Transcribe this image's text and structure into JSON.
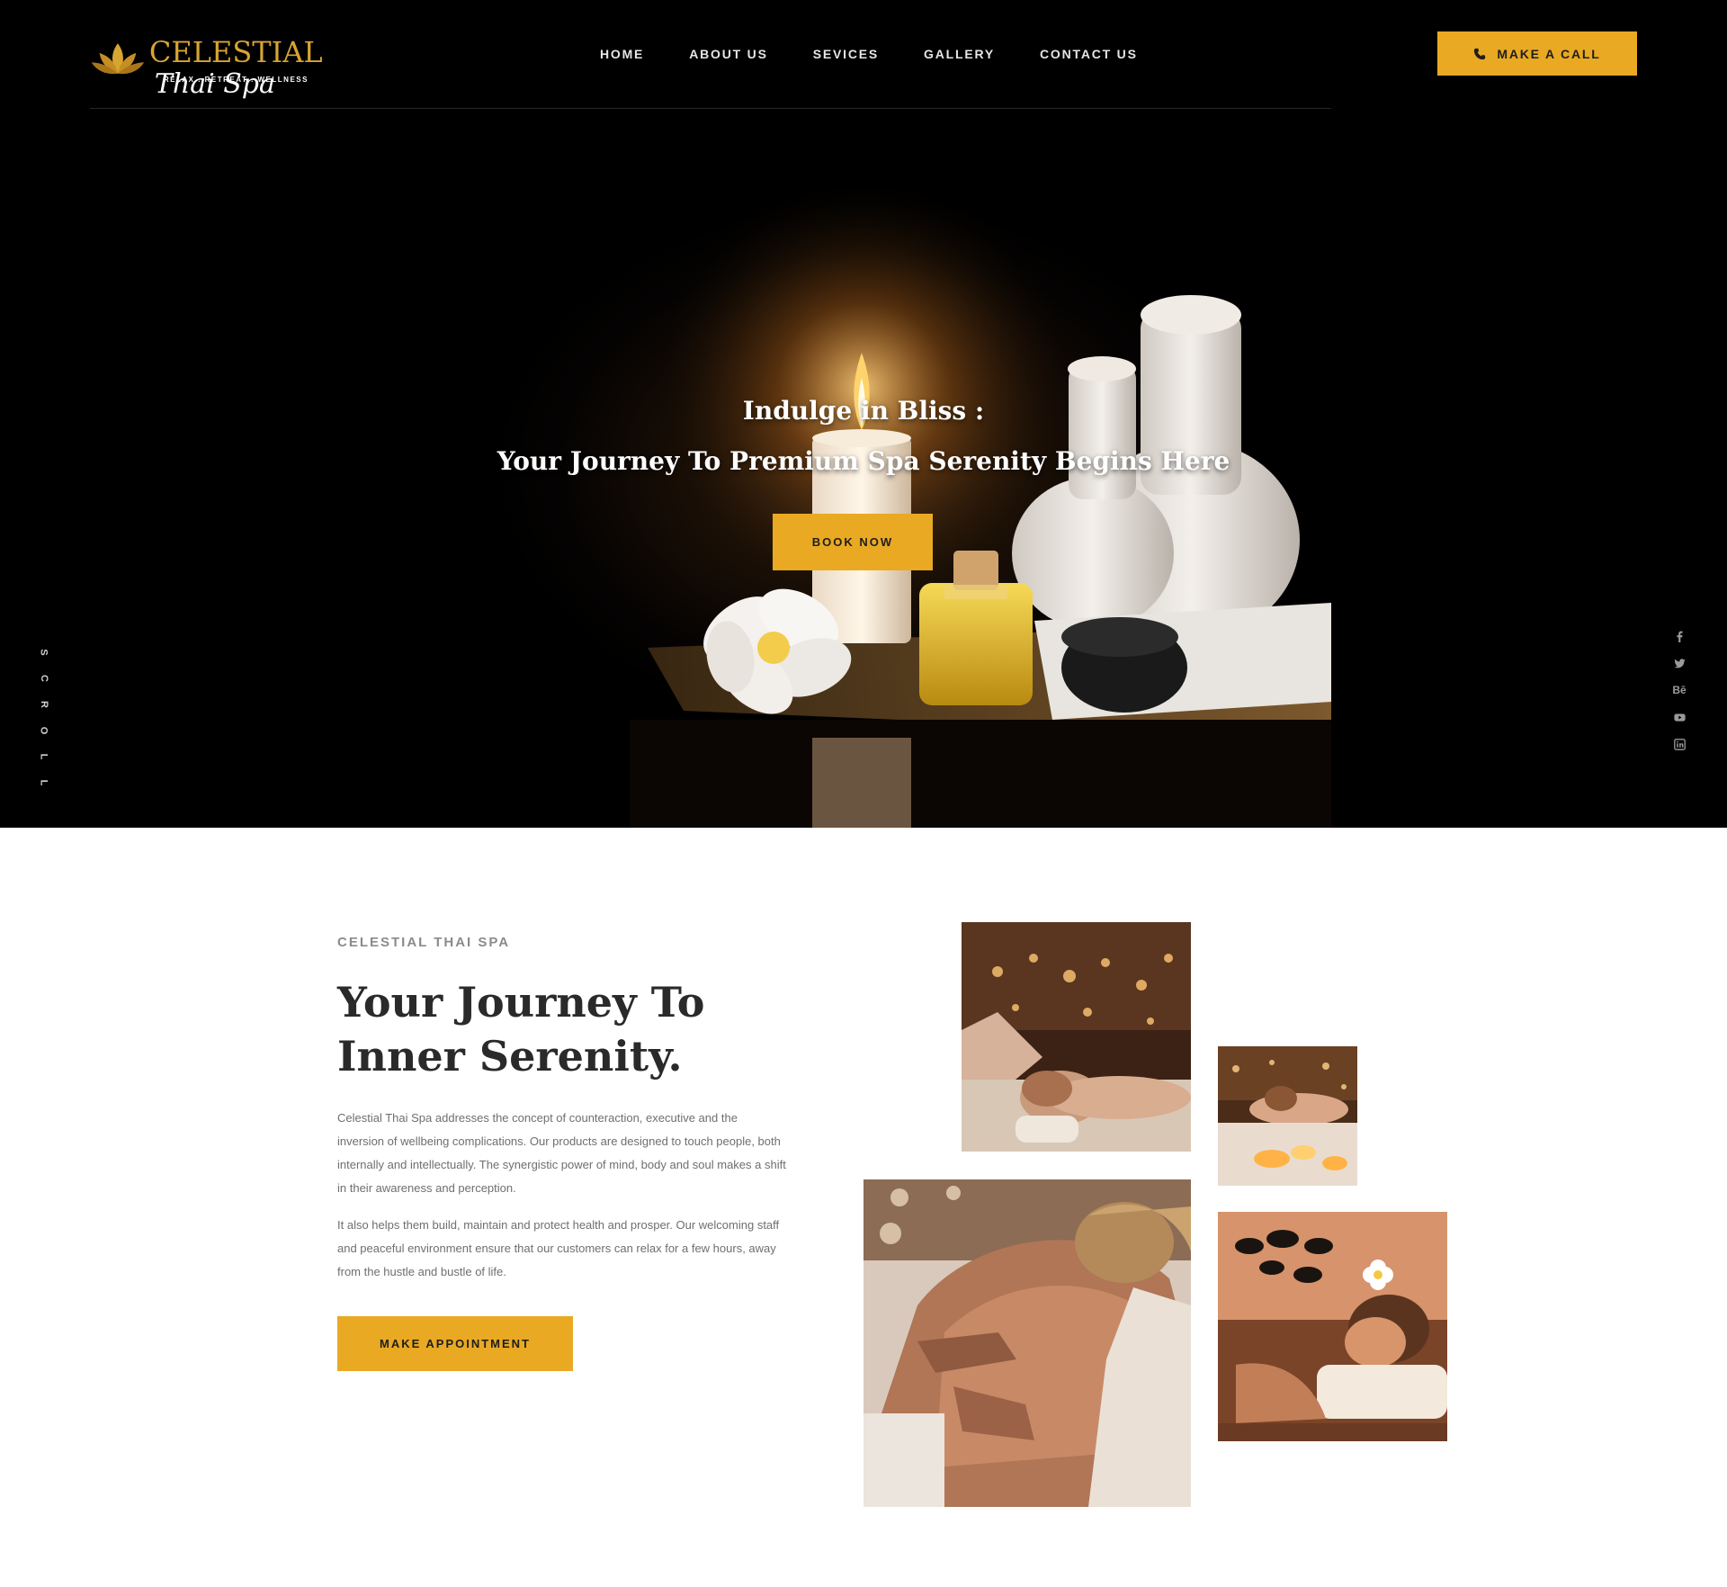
{
  "brand": {
    "name": "CELESTIAL",
    "script": "Thai Spa",
    "tagline": "RELAX . RETREAT . WELLNESS",
    "accent_color": "#e9a923"
  },
  "nav": {
    "items": [
      "HOME",
      "ABOUT US",
      "SEVICES",
      "GALLERY",
      "CONTACT US"
    ]
  },
  "header": {
    "call_label": "MAKE A CALL",
    "call_icon": "phone-icon"
  },
  "hero": {
    "title_line1": "Indulge in Bliss :",
    "title_line2": "Your Journey To Premium Spa Serenity Begins Here",
    "cta_label": "BOOK NOW",
    "scroll_letters": [
      "S",
      "C",
      "R",
      "O",
      "L",
      "L"
    ]
  },
  "social": {
    "icons": [
      "facebook-icon",
      "twitter-icon",
      "behance-icon",
      "youtube-icon",
      "linkedin-icon"
    ],
    "behance_text": "Bē"
  },
  "about": {
    "eyebrow": "CELESTIAL THAI SPA",
    "title": "Your Journey To Inner Serenity.",
    "paragraph1": "Celestial Thai Spa addresses the concept of counteraction, executive and the inversion of wellbeing complications. Our products are designed to touch people, both internally and intellectually. The synergistic power of mind, body and soul makes a shift in their awareness and perception.",
    "paragraph2": "It also helps them build, maintain and protect health and prosper. Our welcoming staff and peaceful environment ensure that our customers can relax for a few hours, away from the hustle and bustle of life.",
    "cta_label": "MAKE APPOINTMENT"
  }
}
